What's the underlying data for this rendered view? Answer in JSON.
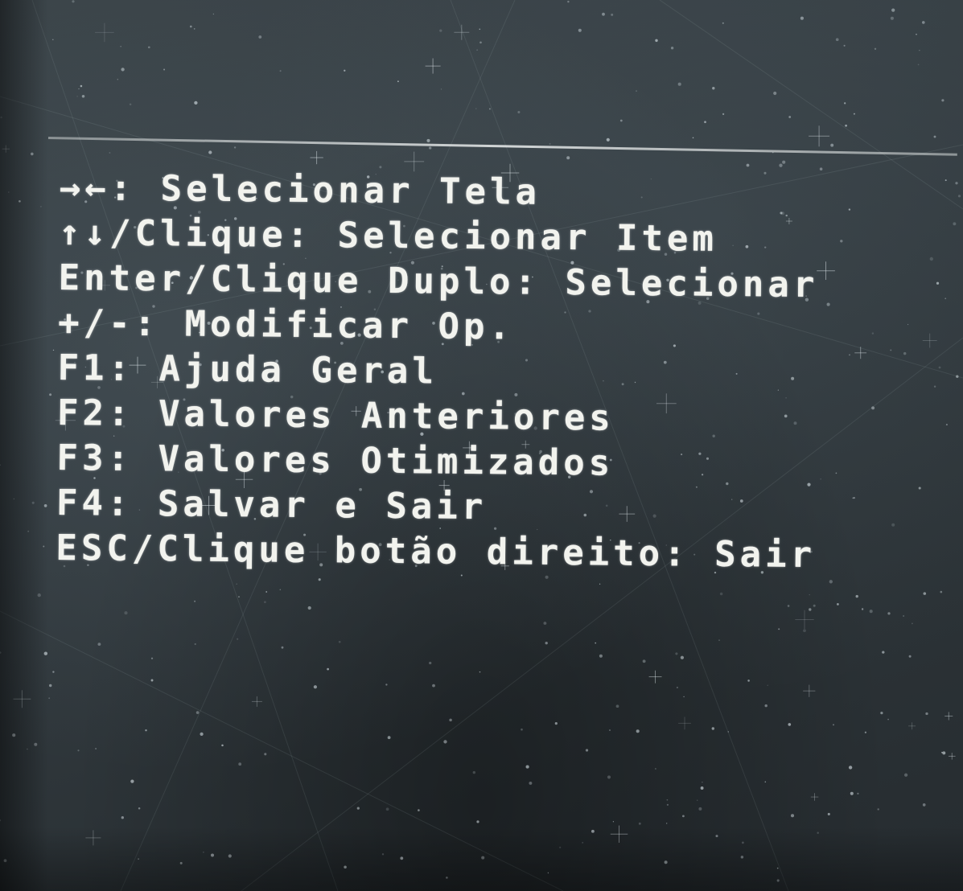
{
  "help_panel": {
    "lines": [
      {
        "keys": "→←",
        "sep": ": ",
        "action": "Selecionar Tela"
      },
      {
        "keys": "↑↓/Clique",
        "sep": ": ",
        "action": "Selecionar Item"
      },
      {
        "keys": "Enter/Clique Duplo",
        "sep": ": ",
        "action": "Selecionar"
      },
      {
        "keys": "+/-",
        "sep": ": ",
        "action": "Modificar Op."
      },
      {
        "keys": "F1",
        "sep": ": ",
        "action": "Ajuda Geral"
      },
      {
        "keys": "F2",
        "sep": ": ",
        "action": "Valores Anteriores"
      },
      {
        "keys": "F3",
        "sep": ": ",
        "action": "Valores Otimizados"
      },
      {
        "keys": "F4",
        "sep": ": ",
        "action": "Salvar e Sair"
      },
      {
        "keys": "ESC/Clique botão direito",
        "sep": ": ",
        "action": "Sair"
      }
    ]
  },
  "colors": {
    "text": "#f2f3ee",
    "background": "#2f363b",
    "divider": "#e6e9e9"
  }
}
